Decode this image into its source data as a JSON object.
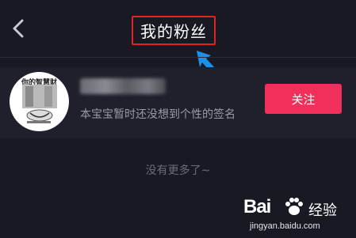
{
  "header": {
    "title": "我的粉丝",
    "back_icon": "chevron-left-icon",
    "highlight_color": "#e0241e",
    "arrow_color": "#1e8fe8"
  },
  "user": {
    "avatar_text": "你的智慧财",
    "signature": "本宝宝暂时还没想到个性的签名",
    "follow_label": "关注",
    "follow_color": "#f0305a"
  },
  "footer": {
    "no_more": "没有更多了~"
  },
  "watermark": {
    "brand": "Bai",
    "brand_suffix": "经验",
    "url": "jingyan.baidu.com"
  }
}
